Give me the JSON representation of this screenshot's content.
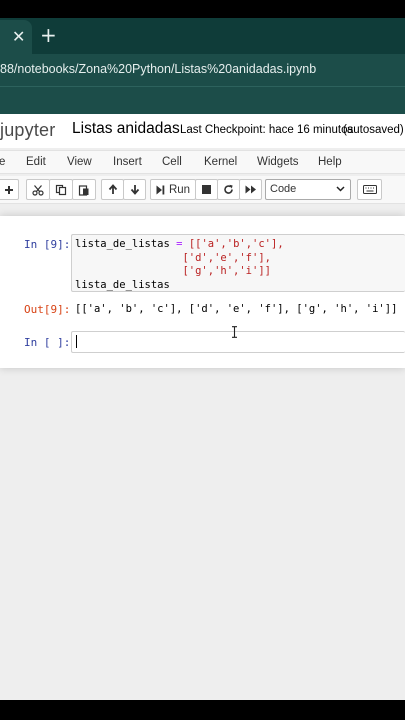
{
  "browser": {
    "tab_close_glyph": "✕",
    "new_tab_glyph": "+",
    "url": "88/notebooks/Zona%20Python/Listas%20anidadas.ipynb"
  },
  "header": {
    "logo": "jupyter",
    "notebook_title": "Listas anidadas",
    "checkpoint": "Last Checkpoint: hace 16 minutos",
    "autosave": "(autosaved)"
  },
  "menu": {
    "items": [
      "e",
      "Edit",
      "View",
      "Insert",
      "Cell",
      "Kernel",
      "Widgets",
      "Help"
    ]
  },
  "toolbar": {
    "run_label": "Run",
    "cell_type": "Code"
  },
  "cells": [
    {
      "prompt": "In [9]:",
      "code_lines": [
        [
          "lista_de_listas ",
          "= ",
          "[['a','b','c'],"
        ],
        [
          "                 ",
          "",
          "['d','e','f'],"
        ],
        [
          "                 ",
          "",
          "['g','h','i']]"
        ],
        [
          "lista_de_listas",
          "",
          ""
        ]
      ],
      "output_prompt": "Out[9]:",
      "output": "[['a', 'b', 'c'], ['d', 'e', 'f'], ['g', 'h', 'i']]"
    },
    {
      "prompt": "In [ ]:",
      "code_lines": []
    }
  ],
  "colors": {
    "browser_dark": "#0f3c39",
    "browser_mid": "#1c4d49",
    "prompt_in": "#303f9f",
    "prompt_out": "#d84315"
  }
}
